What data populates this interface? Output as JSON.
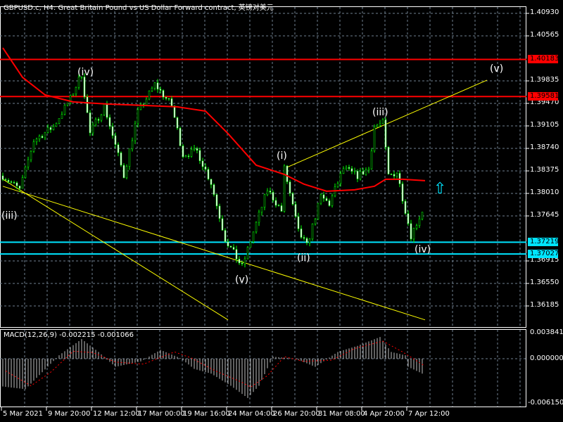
{
  "header": {
    "title": "GBPUSD.c, H4:  Great Britain Pound vs US Dollar Forward contract, 英镑对美元"
  },
  "macd": {
    "label": "MACD(12,26,9) -0.002215 -0.001066",
    "axis_labels": [
      "0.003841",
      "0.000000",
      "-0.006150"
    ],
    "range": [
      -0.00615,
      0.003841
    ]
  },
  "price_axis": {
    "labels": [
      "1.40930",
      "1.40565",
      "1.39835",
      "1.39470",
      "1.39105",
      "1.38740",
      "1.38375",
      "1.38010",
      "1.37645",
      "1.36915",
      "1.36550",
      "1.36185"
    ],
    "top_price": 1.4093,
    "step": 0.00365
  },
  "levels": [
    {
      "price": 1.40183,
      "label": "1.40183",
      "color": "#ff0000"
    },
    {
      "price": 1.39581,
      "label": "1.39581",
      "color": "#ff0000"
    },
    {
      "price": 1.37219,
      "label": "1.37219",
      "color": "#00e5ff"
    },
    {
      "price": 1.37027,
      "label": "1.37027",
      "color": "#00e5ff"
    }
  ],
  "time_axis": [
    "5 Mar 2021",
    "9 Mar 20:00",
    "12 Mar 12:00",
    "17 Mar 00:00",
    "19 Mar 16:00",
    "24 Mar 04:00",
    "26 Mar 20:00",
    "31 Mar 08:00",
    "4 Apr 20:00",
    "7 Apr 12:00"
  ],
  "waves": [
    "(iv)",
    "(iii)",
    "(v)",
    "(i)",
    "(ii)",
    "(iii)",
    "(iv)",
    "(v)"
  ],
  "colors": {
    "bull": "#00ff00",
    "ma": "#ff0000",
    "trend": "#ffff00",
    "grid": "#708090",
    "signal": "#ff0000",
    "hist": "#c0c0c0"
  },
  "chart_data": {
    "type": "candlestick",
    "symbol": "GBPUSD.c",
    "timeframe": "H4",
    "price_pivots": [
      [
        1,
        1.38296
      ],
      [
        7,
        1.38069
      ],
      [
        12,
        1.38867
      ],
      [
        19,
        1.39095
      ],
      [
        25,
        1.39551
      ],
      [
        29,
        1.3995
      ],
      [
        32,
        1.3898
      ],
      [
        37,
        1.39437
      ],
      [
        44,
        1.38296
      ],
      [
        49,
        1.39323
      ],
      [
        55,
        1.39779
      ],
      [
        61,
        1.39437
      ],
      [
        65,
        1.38639
      ],
      [
        70,
        1.38696
      ],
      [
        75,
        1.38183
      ],
      [
        80,
        1.37271
      ],
      [
        86,
        1.36815
      ],
      [
        90,
        1.37385
      ],
      [
        95,
        1.38069
      ],
      [
        100,
        1.37727
      ],
      [
        101,
        1.38411
      ],
      [
        106,
        1.37385
      ],
      [
        109,
        1.37157
      ],
      [
        114,
        1.37955
      ],
      [
        117,
        1.37841
      ],
      [
        122,
        1.38411
      ],
      [
        127,
        1.38296
      ],
      [
        131,
        1.38411
      ],
      [
        133,
        1.39095
      ],
      [
        136,
        1.39152
      ],
      [
        138,
        1.38296
      ],
      [
        141,
        1.38354
      ],
      [
        146,
        1.37328
      ],
      [
        150,
        1.37727
      ],
      [
        151,
        1.37294
      ]
    ],
    "ma_line": [
      [
        0,
        1.40371
      ],
      [
        7,
        1.39893
      ],
      [
        15,
        1.39608
      ],
      [
        25,
        1.39494
      ],
      [
        37,
        1.3946
      ],
      [
        50,
        1.39437
      ],
      [
        62,
        1.39414
      ],
      [
        72,
        1.39345
      ],
      [
        80,
        1.3898
      ],
      [
        90,
        1.38468
      ],
      [
        100,
        1.38319
      ],
      [
        107,
        1.3816
      ],
      [
        115,
        1.38046
      ],
      [
        125,
        1.38069
      ],
      [
        132,
        1.38126
      ],
      [
        136,
        1.3824
      ],
      [
        142,
        1.3824
      ],
      [
        150,
        1.38217
      ]
    ],
    "trendlines": [
      [
        [
          0,
          1.38126
        ],
        [
          150,
          1.35959
        ]
      ],
      [
        [
          0,
          1.3824
        ],
        [
          80,
          1.35959
        ]
      ],
      [
        [
          101,
          1.38434
        ],
        [
          172,
          1.39847
        ]
      ]
    ],
    "macd_hist": [
      [
        1,
        -0.0041
      ],
      [
        9,
        -0.0045
      ],
      [
        15,
        -0.002
      ],
      [
        21,
        0.0005
      ],
      [
        29,
        0.0029
      ],
      [
        35,
        0.001
      ],
      [
        41,
        -0.0012
      ],
      [
        50,
        -0.0004
      ],
      [
        57,
        0.0013
      ],
      [
        64,
        0.0001
      ],
      [
        69,
        -0.0015
      ],
      [
        75,
        -0.0022
      ],
      [
        82,
        -0.004
      ],
      [
        88,
        -0.0058
      ],
      [
        92,
        -0.004
      ],
      [
        97,
        0.0003
      ],
      [
        105,
        0
      ],
      [
        112,
        -0.0012
      ],
      [
        120,
        0.001
      ],
      [
        127,
        0.0019
      ],
      [
        135,
        0.0032
      ],
      [
        139,
        0.001
      ],
      [
        144,
        0.0005
      ],
      [
        145,
        -0.0012
      ],
      [
        151,
        -0.0024
      ]
    ],
    "macd_signal": [
      [
        1,
        -0.0018
      ],
      [
        10,
        -0.004
      ],
      [
        17,
        -0.002
      ],
      [
        25,
        0.0011
      ],
      [
        32,
        0.0009
      ],
      [
        40,
        -0.0005
      ],
      [
        50,
        -0.0008
      ],
      [
        61,
        0.001
      ],
      [
        67,
        0.0001
      ],
      [
        75,
        -0.0017
      ],
      [
        85,
        -0.0035
      ],
      [
        88,
        -0.0042
      ],
      [
        94,
        -0.0025
      ],
      [
        100,
        0.0003
      ],
      [
        107,
        -0.0004
      ],
      [
        117,
        -0.0002
      ],
      [
        125,
        0.0015
      ],
      [
        135,
        0.0026
      ],
      [
        142,
        0.001
      ],
      [
        150,
        -0.0011
      ]
    ]
  }
}
